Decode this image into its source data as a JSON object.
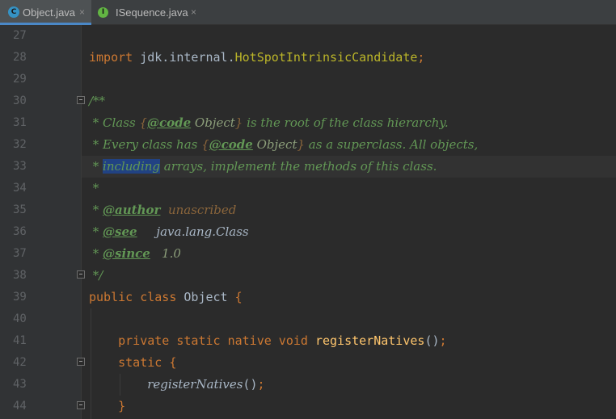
{
  "tabs": [
    {
      "label": "Object.java",
      "icon": "class-icon",
      "icon_letter": "C",
      "close": "×",
      "active": true
    },
    {
      "label": "ISequence.java",
      "icon": "interface-icon",
      "icon_letter": "I",
      "close": "×",
      "active": false
    }
  ],
  "line_numbers": [
    "27",
    "28",
    "29",
    "30",
    "31",
    "32",
    "33",
    "34",
    "35",
    "36",
    "37",
    "38",
    "39",
    "40",
    "41",
    "42",
    "43",
    "44"
  ],
  "code": {
    "l28": {
      "kw": "import",
      "pkg": " jdk.internal.",
      "cls": "HotSpotIntrinsicCandidate",
      "semi": ";"
    },
    "l30": {
      "open": "/**"
    },
    "l31": {
      "a": " * Class ",
      "b": "{",
      "tag": "@code",
      "ref": " Object",
      "c": "}",
      "d": " is the root of the class hierarchy."
    },
    "l32": {
      "a": " * Every class has ",
      "b": "{",
      "tag": "@code",
      "ref": " Object",
      "c": "}",
      "d": " as a superclass. All objects,"
    },
    "l33": {
      "a": " * ",
      "sel": "including",
      "d": " arrays, implement the methods of this class."
    },
    "l34": {
      "a": " *"
    },
    "l35": {
      "a": " * ",
      "tag": "@author",
      "val": "  unascribed"
    },
    "l36": {
      "a": " * ",
      "tag": "@see",
      "val": "     java.lang.Class"
    },
    "l37": {
      "a": " * ",
      "tag": "@since",
      "val": "   1.0"
    },
    "l38": {
      "a": " */"
    },
    "l39": {
      "kw": "public class",
      "name": " Object ",
      "brace": "{"
    },
    "l41": {
      "indent": "    ",
      "kw": "private static native void",
      "sp": " ",
      "method": "registerNatives",
      "parens": "()",
      "semi": ";"
    },
    "l42": {
      "indent": "    ",
      "kw": "static",
      "sp": " ",
      "brace": "{"
    },
    "l43": {
      "indent": "        ",
      "method": "registerNatives",
      "parens": "()",
      "semi": ";"
    },
    "l44": {
      "indent": "    ",
      "brace": "}"
    }
  },
  "colors": {
    "background": "#2b2b2b",
    "keyword": "#cc7832",
    "javadoc": "#629755",
    "method": "#ffc66d",
    "selection": "#214283"
  }
}
